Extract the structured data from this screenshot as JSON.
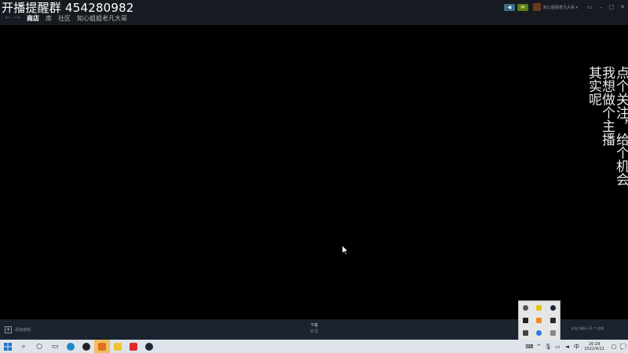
{
  "stream_title": "开播提醒群  454280982",
  "nav": {
    "back_icon": "left-arrow-icon",
    "forward_icon": "right-arrow-icon",
    "items": [
      "商店",
      "库",
      "社区",
      "知心姐姐老凡大哥"
    ]
  },
  "header": {
    "account_name": "知心姐姐老凡大哥",
    "account_caret": "▾"
  },
  "overlay_text": {
    "col1": "点个关注，给个机会",
    "col2": "我想做个主播",
    "col3": "其实呢"
  },
  "bottom": {
    "add_game": "添加游戏",
    "downloads": "下载",
    "downloads_sub": "管理",
    "friends_chat": "好友与聊天 23 个 在线"
  },
  "taskbar": {
    "time": "20:29",
    "date": "2022/4/11"
  },
  "colors": {
    "steam_header": "#171a21",
    "steam_bottom": "#1b2230",
    "taskbar": "#dfe4ea",
    "friends_button": "#5c7e10",
    "broadcast_button": "#3d6c8d"
  }
}
